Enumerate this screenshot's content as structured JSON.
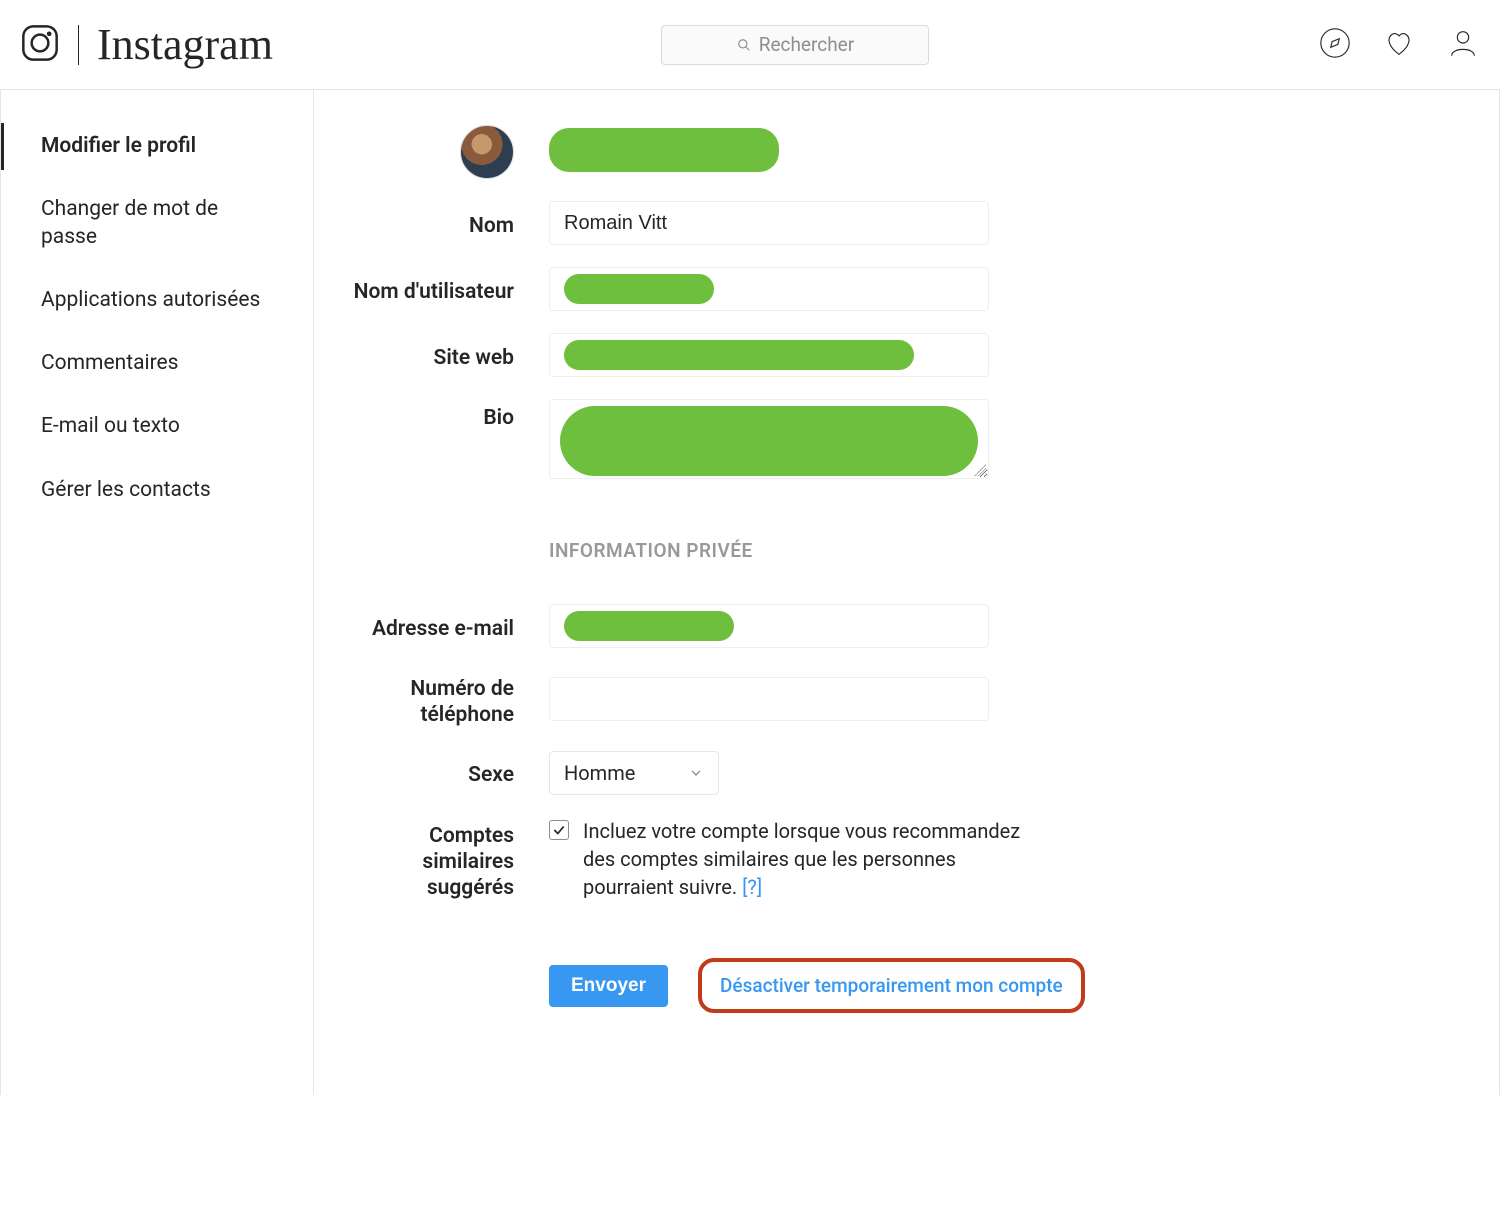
{
  "header": {
    "brand": "Instagram",
    "search_placeholder": "Rechercher"
  },
  "sidebar": {
    "items": [
      {
        "label": "Modifier le profil",
        "active": true
      },
      {
        "label": "Changer de mot de passe",
        "active": false
      },
      {
        "label": "Applications autorisées",
        "active": false
      },
      {
        "label": "Commentaires",
        "active": false
      },
      {
        "label": "E-mail ou texto",
        "active": false
      },
      {
        "label": "Gérer les contacts",
        "active": false
      }
    ]
  },
  "form": {
    "labels": {
      "name": "Nom",
      "username": "Nom d'utilisateur",
      "website": "Site web",
      "bio": "Bio",
      "private_header": "INFORMATION PRIVÉE",
      "email": "Adresse e-mail",
      "phone": "Numéro de téléphone",
      "gender": "Sexe",
      "similar": "Comptes similaires suggérés"
    },
    "values": {
      "name": "Romain Vitt",
      "phone": "",
      "gender": "Homme"
    },
    "similar_text": "Incluez votre compte lorsque vous recommandez des comptes similaires que les personnes pourraient suivre. ",
    "help_link": "[?]",
    "submit": "Envoyer",
    "deactivate": "Désactiver temporairement mon compte"
  }
}
